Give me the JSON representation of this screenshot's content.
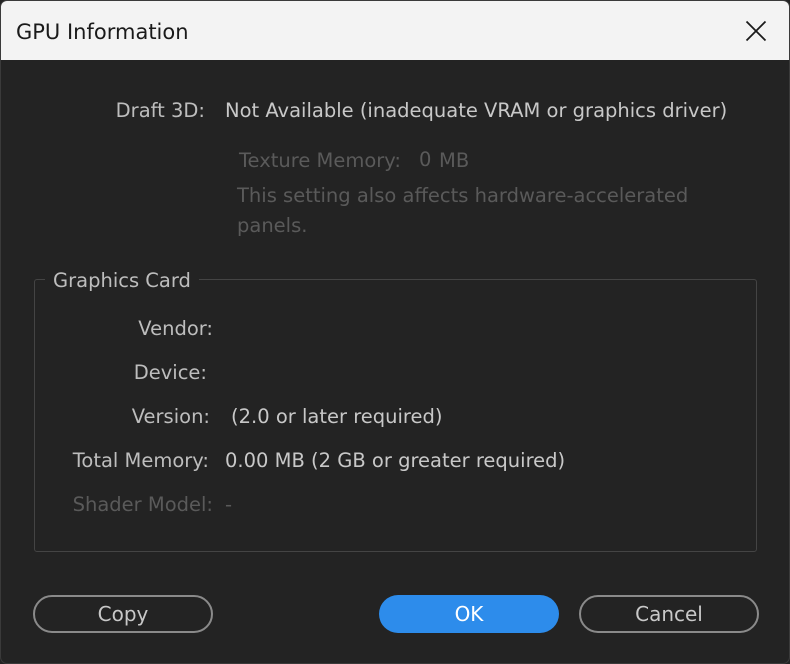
{
  "window": {
    "title": "GPU Information"
  },
  "draft3d": {
    "label": "Draft 3D:",
    "value": "Not Available (inadequate VRAM or graphics driver)",
    "texture_memory_label": "Texture Memory:",
    "texture_memory_value": "0",
    "texture_memory_unit": "MB",
    "note_line1": "This setting also affects hardware-accelerated",
    "note_line2": "panels."
  },
  "graphics_card": {
    "title": "Graphics Card",
    "vendor_label": "Vendor:",
    "vendor_value": "",
    "device_label": "Device:",
    "device_value": "",
    "version_label": "Version:",
    "version_value": "(2.0 or later required)",
    "total_memory_label": "Total Memory:",
    "total_memory_value": "0.00 MB (2 GB or greater required)",
    "shader_model_label": "Shader Model:",
    "shader_model_value": "-"
  },
  "buttons": {
    "copy": "Copy",
    "ok": "OK",
    "cancel": "Cancel"
  },
  "colors": {
    "primary": "#2d8ceb",
    "background": "#232323",
    "titlebar": "#f3f3f3"
  }
}
